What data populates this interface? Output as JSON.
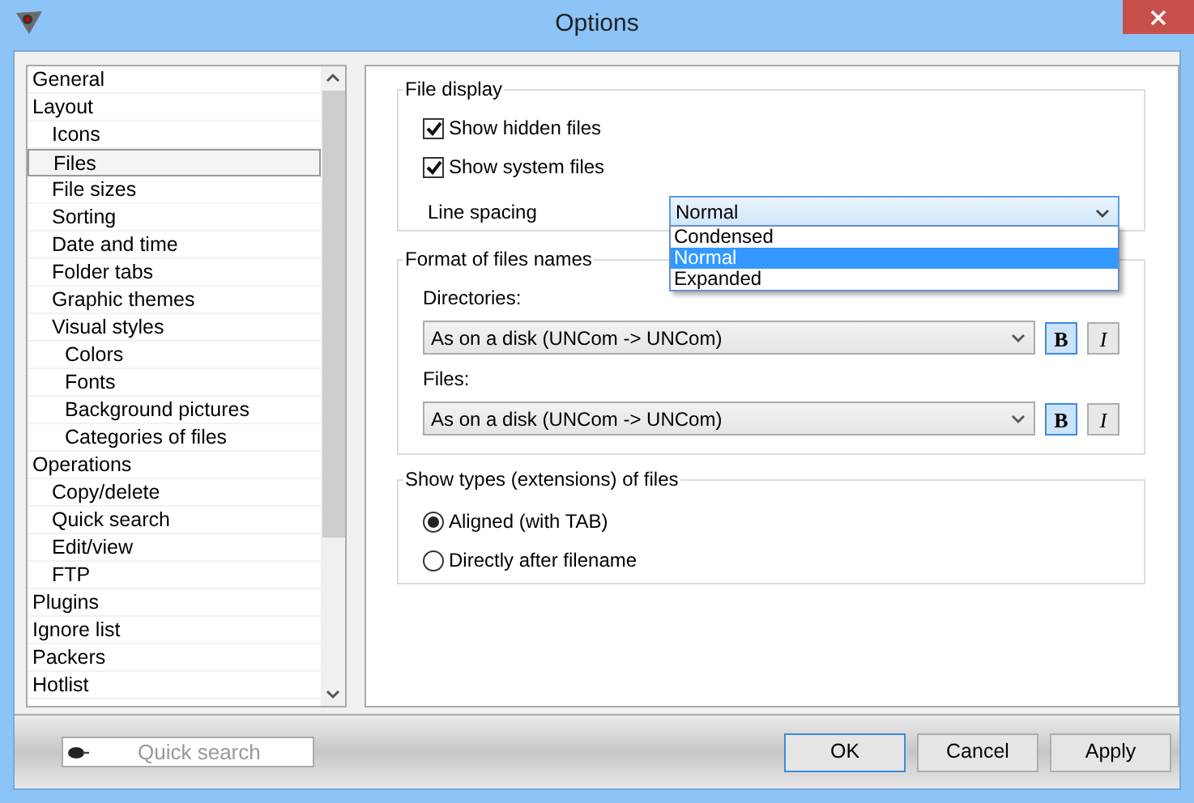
{
  "window": {
    "title": "Options"
  },
  "tree": [
    {
      "label": "General",
      "selected": false
    },
    {
      "label": "Layout",
      "selected": false,
      "children": [
        {
          "label": "Icons",
          "selected": false
        },
        {
          "label": "Files",
          "selected": true
        },
        {
          "label": "File sizes",
          "selected": false
        },
        {
          "label": "Sorting",
          "selected": false
        },
        {
          "label": "Date and time",
          "selected": false
        },
        {
          "label": "Folder tabs",
          "selected": false
        },
        {
          "label": "Graphic themes",
          "selected": false
        },
        {
          "label": "Visual styles",
          "selected": false,
          "children": [
            {
              "label": "Colors",
              "selected": false
            },
            {
              "label": "Fonts",
              "selected": false
            },
            {
              "label": "Background pictures",
              "selected": false
            },
            {
              "label": "Categories of files",
              "selected": false
            }
          ]
        }
      ]
    },
    {
      "label": "Operations",
      "selected": false,
      "children": [
        {
          "label": "Copy/delete",
          "selected": false
        },
        {
          "label": "Quick search",
          "selected": false
        },
        {
          "label": "Edit/view",
          "selected": false
        },
        {
          "label": "FTP",
          "selected": false
        }
      ]
    },
    {
      "label": "Plugins",
      "selected": false
    },
    {
      "label": "Ignore list",
      "selected": false
    },
    {
      "label": "Packers",
      "selected": false
    },
    {
      "label": "Hotlist",
      "selected": false
    }
  ],
  "file_display": {
    "title": "File display",
    "checkboxes": [
      {
        "label": "Show hidden files",
        "checked": true
      },
      {
        "label": "Show system files",
        "checked": true
      }
    ],
    "line_spacing": {
      "label": "Line spacing",
      "value": "Normal",
      "expanded": true,
      "options": [
        {
          "label": "Condensed",
          "selected": false
        },
        {
          "label": "Normal",
          "selected": true
        },
        {
          "label": "Expanded",
          "selected": false
        }
      ]
    }
  },
  "format": {
    "title": "Format of files names",
    "fields": [
      {
        "label": "Directories:",
        "value": "As on a disk (UNCom -> UNCom)",
        "bold": true,
        "italic": false,
        "bold_label": "B",
        "italic_label": "I"
      },
      {
        "label": "Files:",
        "value": "As on a disk (UNCom -> UNCom)",
        "bold": true,
        "italic": false,
        "bold_label": "B",
        "italic_label": "I"
      }
    ]
  },
  "extensions": {
    "title": "Show types (extensions) of files",
    "radios": [
      {
        "label": "Aligned (with TAB)",
        "selected": true
      },
      {
        "label": "Directly after filename",
        "selected": false
      }
    ]
  },
  "quick_search": {
    "placeholder": "Quick search"
  },
  "buttons": [
    {
      "label": "OK",
      "default": true
    },
    {
      "label": "Cancel",
      "default": false
    },
    {
      "label": "Apply",
      "default": false
    }
  ]
}
